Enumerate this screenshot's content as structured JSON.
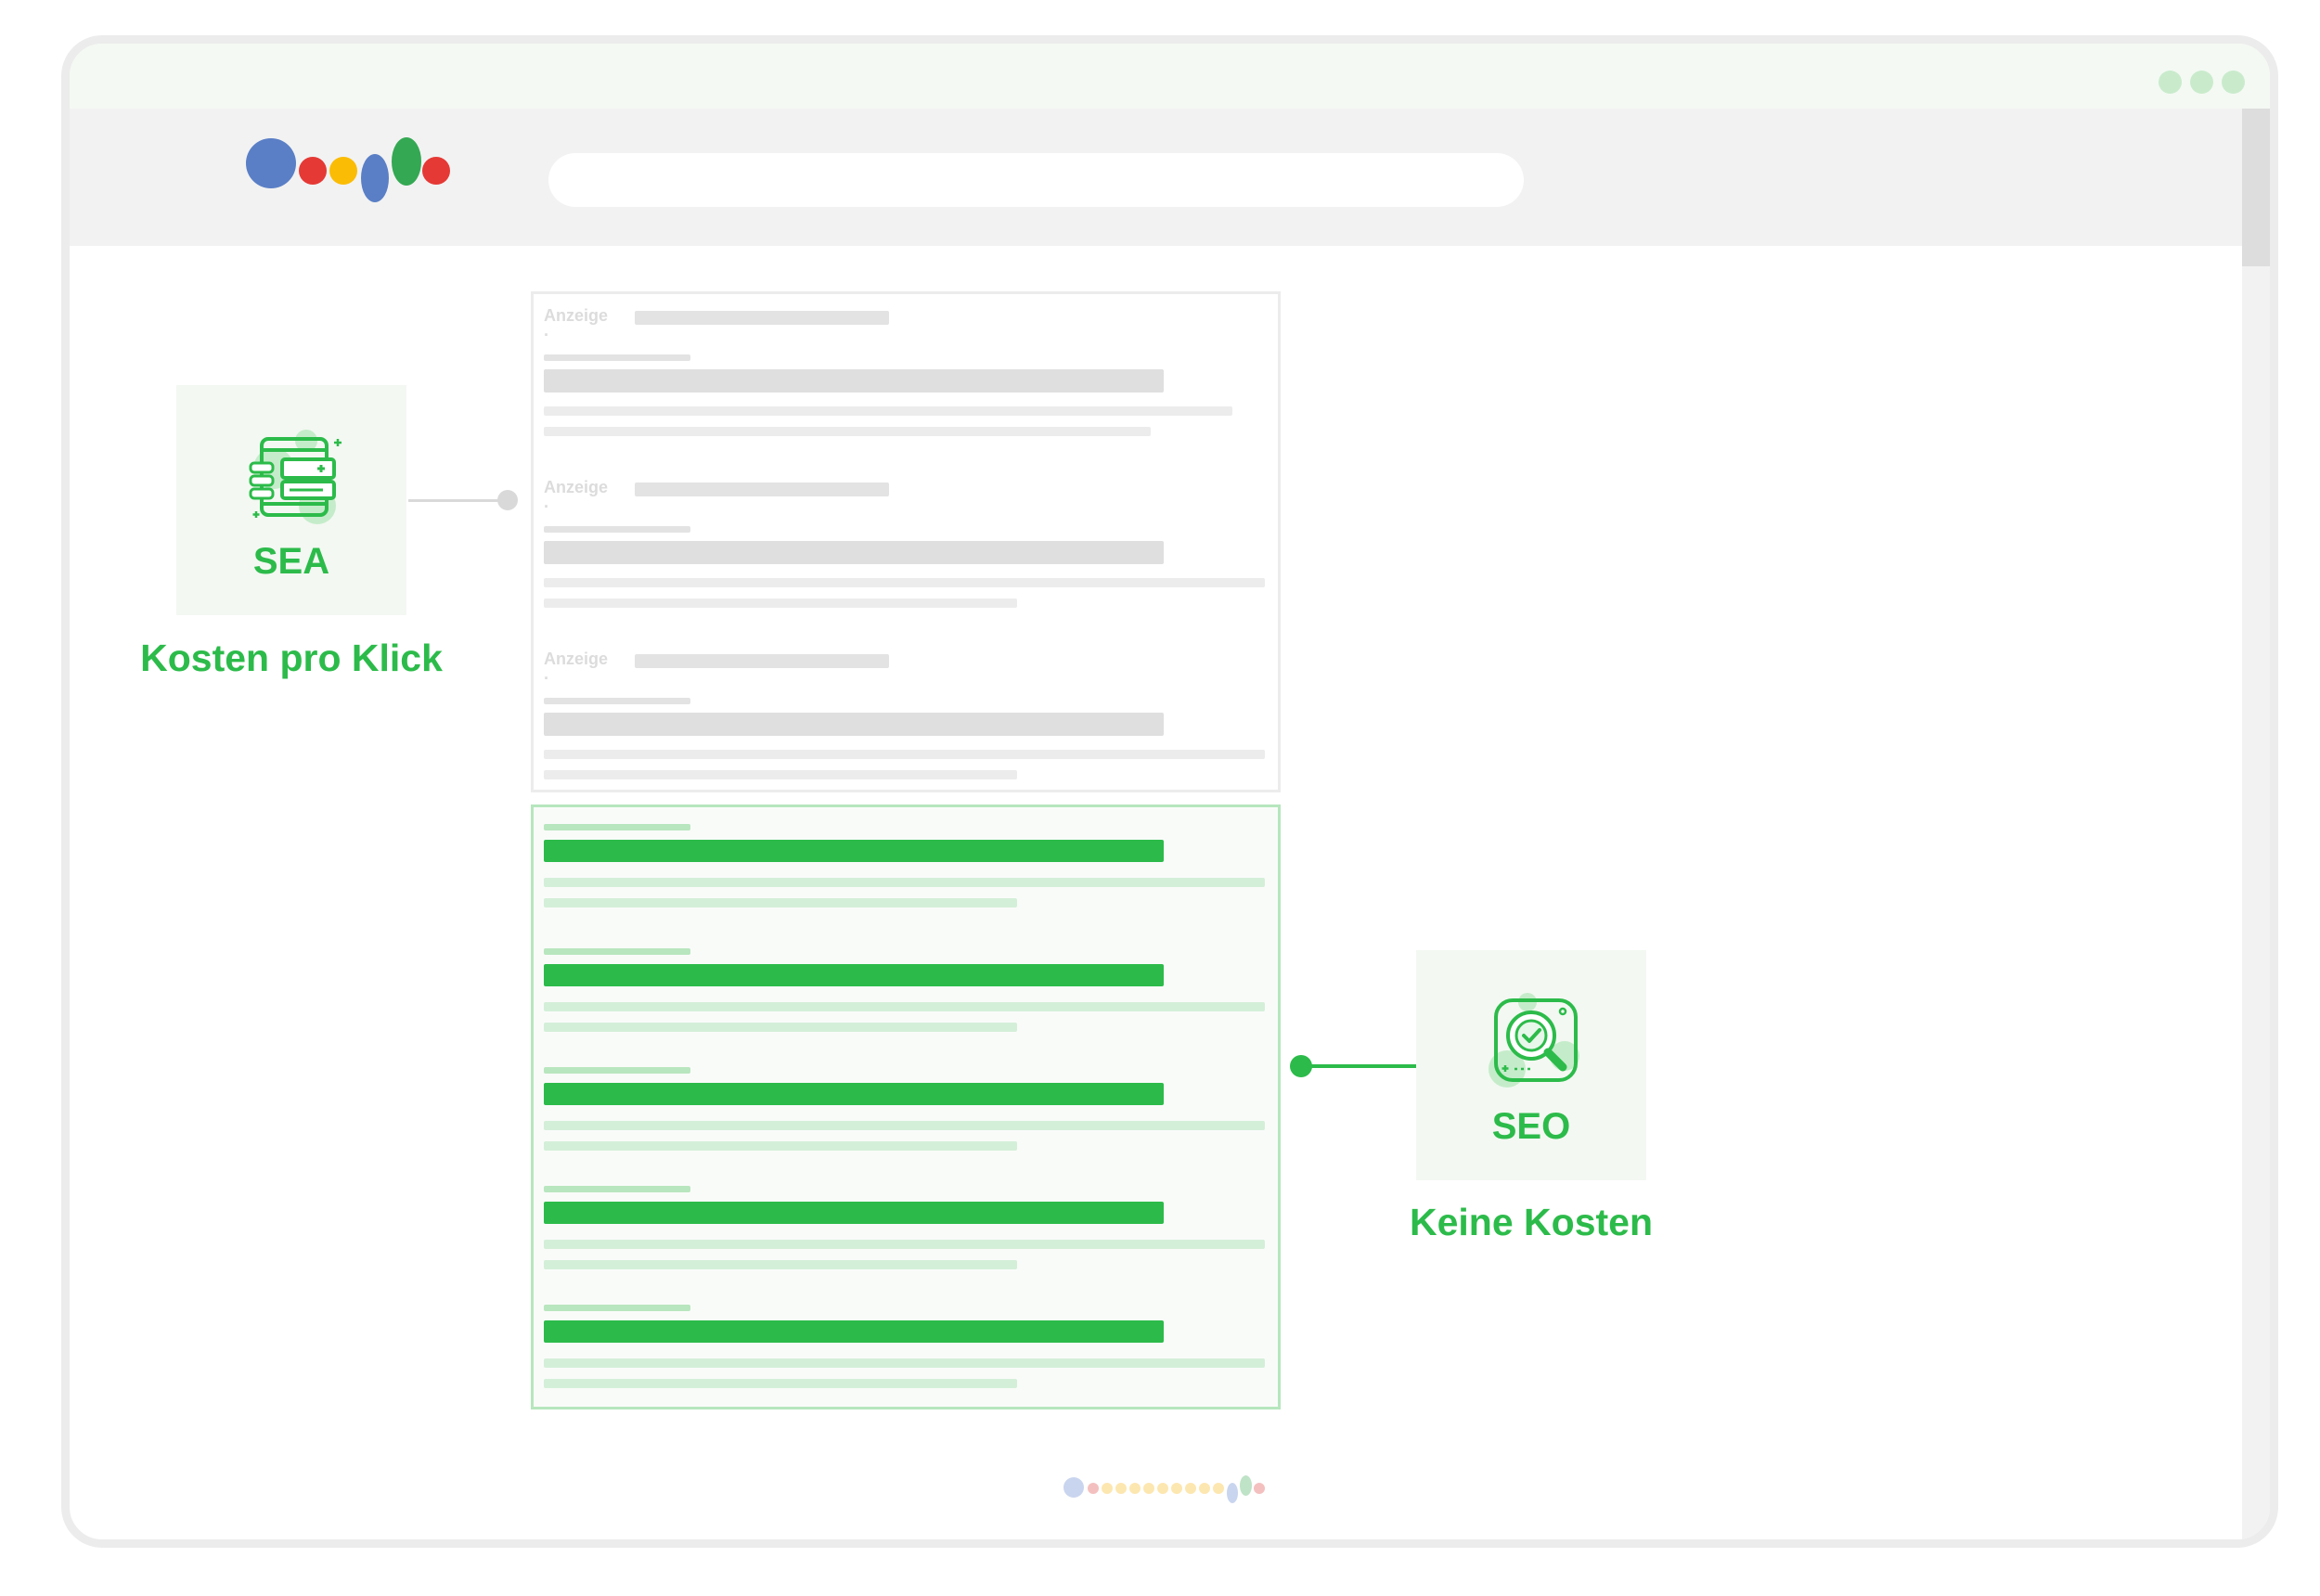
{
  "ads_block": {
    "ad_label": "Anzeige ·",
    "ads": [
      {
        "label": "Anzeige ·"
      },
      {
        "label": "Anzeige ·"
      },
      {
        "label": "Anzeige ·"
      }
    ]
  },
  "organic_block": {
    "result_count": 5
  },
  "sea_card": {
    "title": "SEA",
    "caption": "Kosten pro Klick",
    "icon": "ad-device-icon"
  },
  "seo_card": {
    "title": "SEO",
    "caption": "Keine Kosten",
    "icon": "magnifier-check-icon"
  },
  "colors": {
    "accent_green": "#2cbb4a",
    "placeholder_gray": "#dfdfdf",
    "light_green": "#d4efd8",
    "logo_blue": "#5a7fc6",
    "logo_red": "#e53935",
    "logo_yellow": "#fbbc05",
    "logo_green": "#34a853"
  }
}
